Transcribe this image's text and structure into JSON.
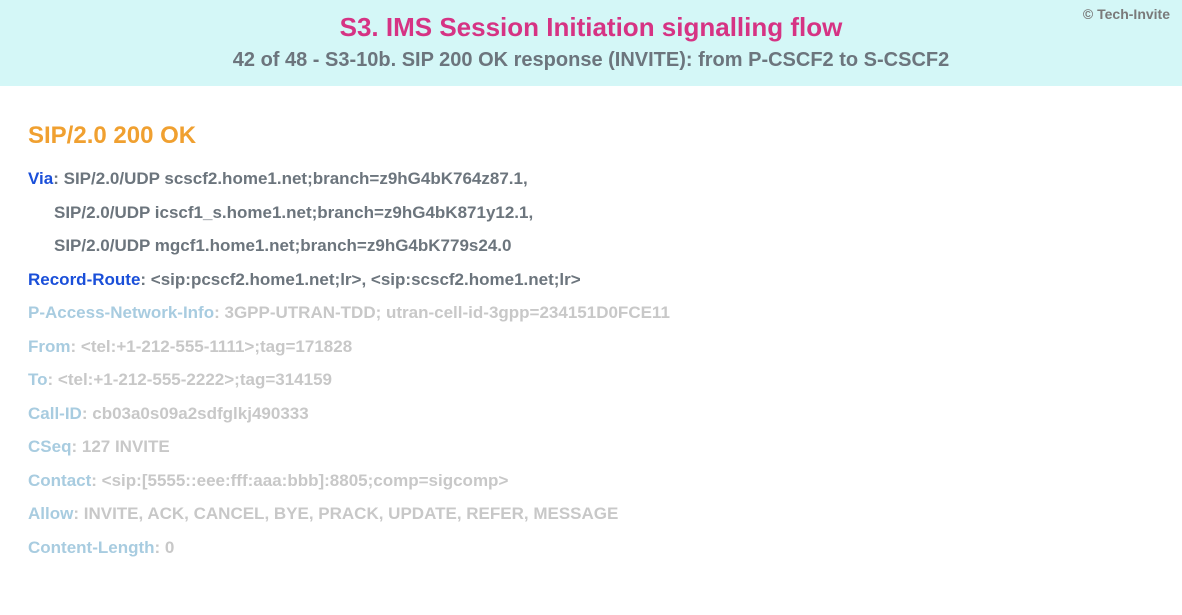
{
  "copyright": "© Tech-Invite",
  "header": {
    "title": "S3. IMS Session Initiation signalling flow",
    "subtitle": "42 of 48 - S3-10b. SIP 200 OK response (INVITE): from P-CSCF2 to S-CSCF2"
  },
  "sip": {
    "status_line": "SIP/2.0 200 OK",
    "via": {
      "label": "Via",
      "lines": [
        "SIP/2.0/UDP scscf2.home1.net;branch=z9hG4bK764z87.1,",
        "SIP/2.0/UDP icscf1_s.home1.net;branch=z9hG4bK871y12.1,",
        "SIP/2.0/UDP mgcf1.home1.net;branch=z9hG4bK779s24.0"
      ]
    },
    "record_route": {
      "label": "Record-Route",
      "value": "<sip:pcscf2.home1.net;lr>, <sip:scscf2.home1.net;lr>"
    },
    "p_access_network_info": {
      "label": "P-Access-Network-Info",
      "value": "3GPP-UTRAN-TDD; utran-cell-id-3gpp=234151D0FCE11"
    },
    "from": {
      "label": "From",
      "value": "<tel:+1-212-555-1111>;tag=171828"
    },
    "to": {
      "label": "To",
      "value": "<tel:+1-212-555-2222>;tag=314159"
    },
    "call_id": {
      "label": "Call-ID",
      "value": "cb03a0s09a2sdfglkj490333"
    },
    "cseq": {
      "label": "CSeq",
      "value": "127 INVITE"
    },
    "contact": {
      "label": "Contact",
      "value": "<sip:[5555::eee:fff:aaa:bbb]:8805;comp=sigcomp>"
    },
    "allow": {
      "label": "Allow",
      "value": "INVITE, ACK, CANCEL, BYE, PRACK, UPDATE, REFER, MESSAGE"
    },
    "content_length": {
      "label": "Content-Length",
      "value": "0"
    }
  }
}
